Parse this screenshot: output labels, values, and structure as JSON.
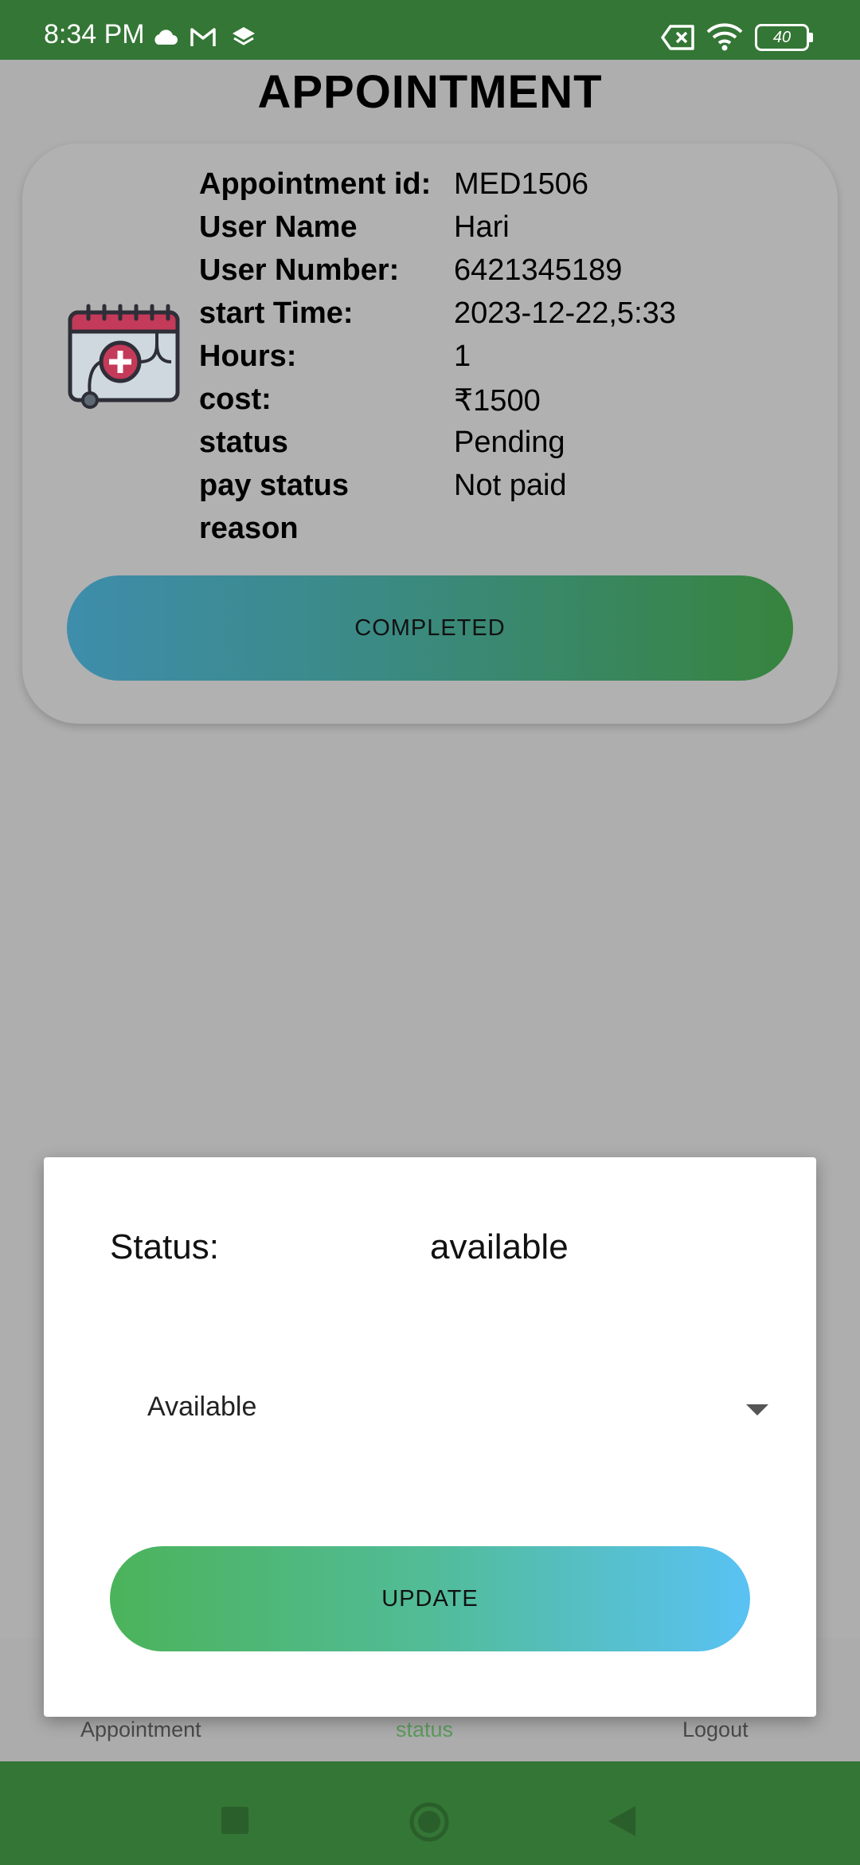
{
  "status_bar": {
    "time": "8:34 PM",
    "battery": "40",
    "icons": [
      "cloud-icon",
      "gmail-icon",
      "layers-icon",
      "sim-off-icon",
      "wifi-icon",
      "battery-icon"
    ]
  },
  "page": {
    "title": "APPOINTMENT"
  },
  "appointment": {
    "icon": "calendar-medical-icon",
    "rows": [
      {
        "label": "Appointment id:",
        "value": "MED1506"
      },
      {
        "label": "User Name",
        "value": "Hari"
      },
      {
        "label": "User Number:",
        "value": "6421345189"
      },
      {
        "label": "start Time:",
        "value": "2023-12-22,5:33"
      },
      {
        "label": "Hours:",
        "value": "1"
      },
      {
        "label": "cost:",
        "value": "₹1500"
      },
      {
        "label": "status",
        "value": "Pending"
      },
      {
        "label": "pay status",
        "value": "Not paid"
      },
      {
        "label": "reason",
        "value": ""
      }
    ],
    "completed_button": "COMPLETED"
  },
  "dialog": {
    "status_label": "Status:",
    "status_value": "available",
    "dropdown_selected": "Available",
    "update_button": "UPDATE"
  },
  "bottom_nav": {
    "items": [
      {
        "label": "Appointment",
        "active": false
      },
      {
        "label": "status",
        "active": true
      },
      {
        "label": "Logout",
        "active": false
      }
    ]
  },
  "colors": {
    "status_bar": "#347635",
    "accent_green": "#4bb35a",
    "accent_blue": "#59c2f4",
    "nav_active": "#5c9b5e"
  }
}
